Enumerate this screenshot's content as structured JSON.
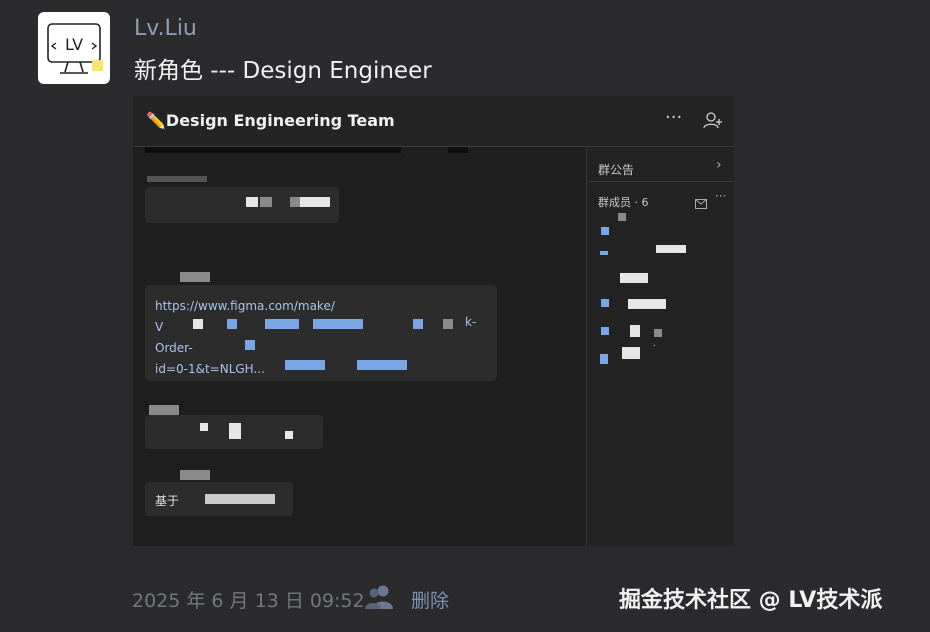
{
  "post": {
    "username": "Lv.Liu",
    "title": "新角色 --- Design Engineer",
    "timestamp": "2025 年 6 月 13 日 09:52",
    "delete_label": "删除",
    "avatar_text": "LV"
  },
  "screenshot": {
    "team_name": "✏️Design Engineering Team",
    "more_icon": "···",
    "side_panel": {
      "notice_label": "群公告",
      "notice_arrow": "›",
      "members_label": "群成员 · 6",
      "more_icon": "···"
    },
    "messages": {
      "link_lines": [
        "https://www.figma.com/make/",
        "V",
        "Order-",
        "id=0-1&t=NLGH..."
      ],
      "link_suffix_right": "k-",
      "first_chars": "基于"
    }
  },
  "watermark": "掘金技术社区 @ LV技术派",
  "icons": {
    "add_member": "add-user-icon",
    "mail": "mail-icon",
    "people": "people-icon"
  },
  "colors": {
    "background": "#2b2b2d",
    "username": "#8f9db3",
    "link": "#a7c4ee",
    "delete": "#7f92b4"
  }
}
